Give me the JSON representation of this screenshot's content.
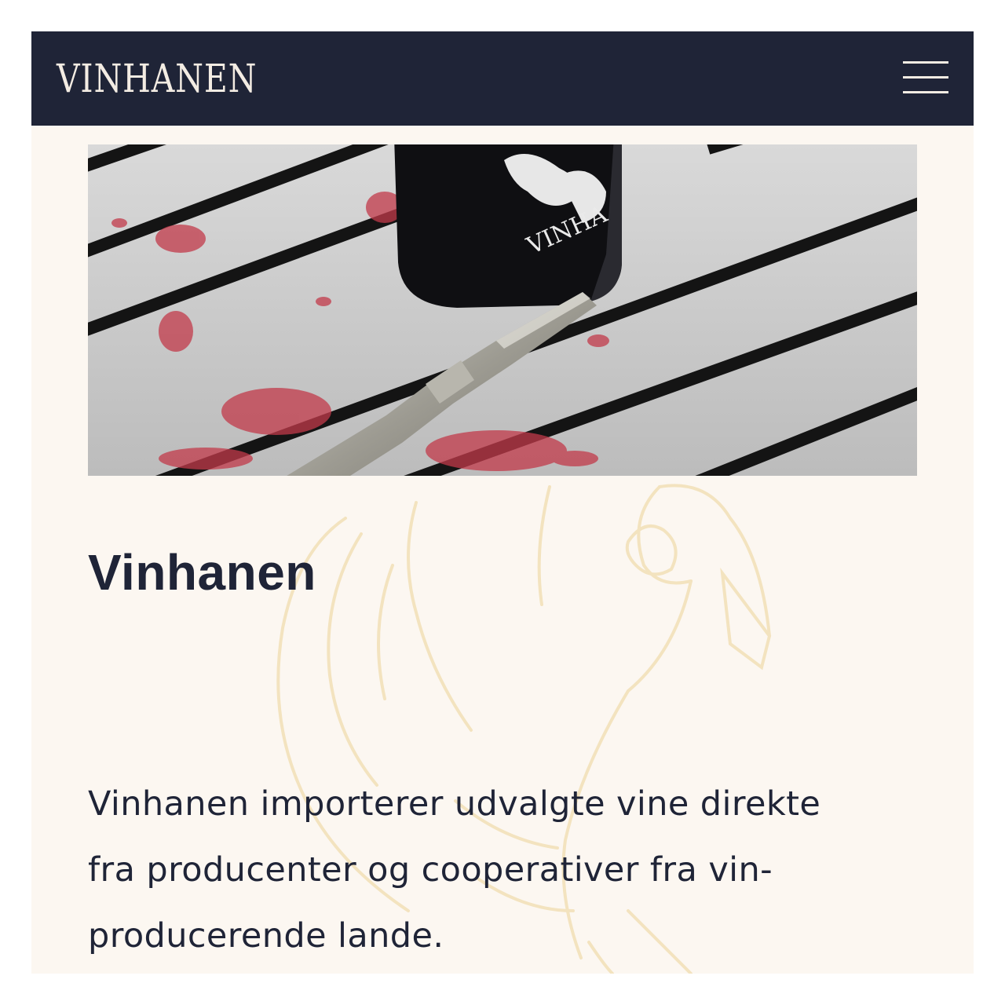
{
  "header": {
    "logo_text": "VINHANEN",
    "menu_icon": "hamburger-menu-icon"
  },
  "hero": {
    "bottle_label": "VINHA"
  },
  "main": {
    "title": "Vinhanen",
    "intro_lines": [
      "Vinhanen importerer udvalgte vine direkte",
      "fra producenter og cooperativer fra vin-",
      "producerende lande."
    ]
  },
  "colors": {
    "navbar": "#1f2437",
    "page_background": "#fcf7f1",
    "text": "#1f2437",
    "logo": "#f3ece3",
    "wine_stain": "#b3263a",
    "watermark": "#f3e3bf"
  }
}
